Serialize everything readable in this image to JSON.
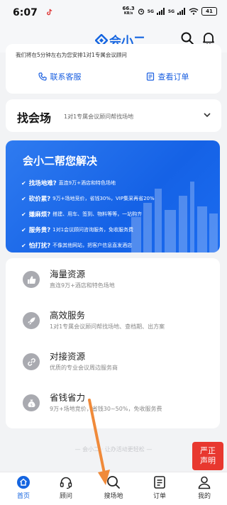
{
  "status_bar": {
    "time": "6:07",
    "speed_value": "66.3",
    "speed_unit": "KB/s",
    "signal_1": "5G",
    "signal_2": "5G",
    "battery": "41"
  },
  "header": {
    "app_name": "会小二",
    "brand_color": "#1565e0"
  },
  "notice_card": {
    "text": "我们将在5分钟左右为您安排1对1专属会议顾问",
    "service_button": "联系客服",
    "orders_button": "查看订单"
  },
  "find_venue": {
    "title": "找会场",
    "subtitle": "1对1专属会议顾问帮找场地"
  },
  "banner": {
    "title": "会小二帮您解决",
    "items": [
      {
        "key": "找场地难?",
        "text": "直连9万+酒店和特色场地"
      },
      {
        "key": "砍价累?",
        "text": "9万+场地竞价，省钱30%，VIP集采再省20%"
      },
      {
        "key": "嫌麻烦?",
        "text": "搭建、用车、签到、物料等等，一站购齐"
      },
      {
        "key": "服务贵?",
        "text": "1对1会议顾问咨询服务，免收服务费"
      },
      {
        "key": "怕打扰?",
        "text": "不像其他网站，把客户信息直发酒店"
      }
    ]
  },
  "features": [
    {
      "icon": "thumbs-up-icon",
      "title": "海量资源",
      "subtitle": "直连9万+酒店和特色场地"
    },
    {
      "icon": "rocket-icon",
      "title": "高效服务",
      "subtitle": "1对1专属会议顾问帮找场地、查档期、出方案"
    },
    {
      "icon": "link-icon",
      "title": "对接资源",
      "subtitle": "优质的专业会议周边服务商"
    },
    {
      "icon": "money-bag-icon",
      "title": "省钱省力",
      "subtitle": "9万+场地竞价，省钱30~50%，免收服务费"
    }
  ],
  "slogan": "— 会小二 · 让办活动更轻松 —",
  "badge": {
    "line1": "严正",
    "line2": "声明",
    "color": "#e8382f"
  },
  "tabs": [
    {
      "label": "首页",
      "icon": "home-icon",
      "active": true
    },
    {
      "label": "顾问",
      "icon": "headset-icon",
      "active": false
    },
    {
      "label": "搜场地",
      "icon": "search-icon",
      "active": false
    },
    {
      "label": "订单",
      "icon": "orders-icon",
      "active": false
    },
    {
      "label": "我的",
      "icon": "profile-icon",
      "active": false
    }
  ]
}
